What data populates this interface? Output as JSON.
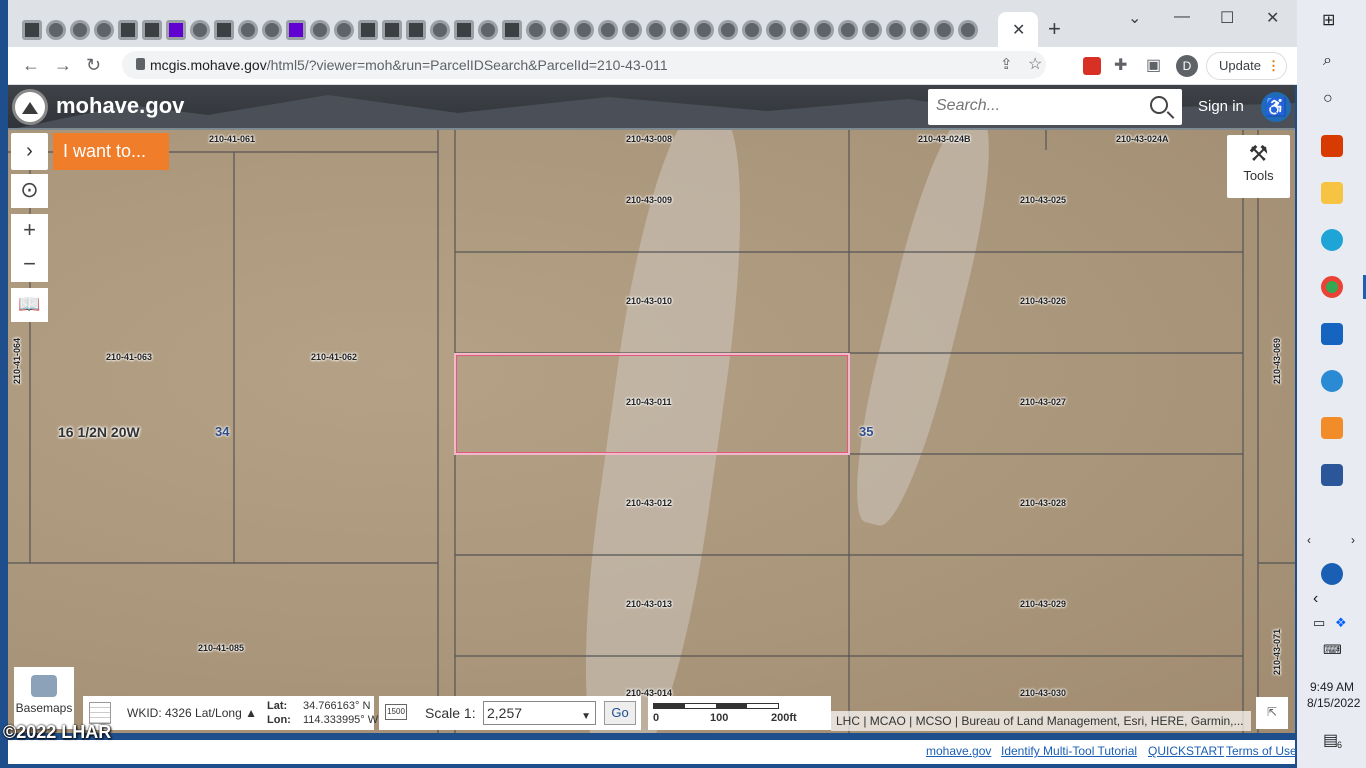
{
  "browser": {
    "url_host": "mcgis.mohave.gov",
    "url_path": "/html5/?viewer=moh&run=ParcelIDSearch&ParcelId=210-43-011",
    "update_label": "Update",
    "profile_initial": "D",
    "new_tab_glyph": "+",
    "close_tab_glyph": "✕"
  },
  "header": {
    "site_name": "mohave.gov",
    "search_placeholder": "Search...",
    "signin_label": "Sign in",
    "accessibility_icon": "accessibility-icon"
  },
  "map_ui": {
    "iwant_label": "I want to...",
    "tools_label": "Tools",
    "basemaps_label": "Basemaps",
    "wkid_label": "WKID: 4326 Lat/Long ▲",
    "lat_label": "Lat:",
    "lon_label": "Lon:",
    "lat_value": "34.766163° N",
    "lon_value": "114.333995° W",
    "scale_label": "Scale 1:",
    "scale_value": "2,257",
    "scale_icon_text": "1500",
    "go_label": "Go",
    "scalebar_ticks": [
      "0",
      "100",
      "200ft"
    ],
    "attribution": "LHC | MCAO | MCSO | Bureau of Land Management, Esri, HERE, Garmin,..."
  },
  "map": {
    "township": "16 1/2N 20W",
    "sections": [
      "34",
      "35"
    ],
    "parcels": [
      "210-41-061",
      "210-43-008",
      "210-43-024B",
      "210-43-024A",
      "210-43-009",
      "210-43-025",
      "210-43-010",
      "210-43-026",
      "210-41-063",
      "210-41-062",
      "210-43-011",
      "210-43-027",
      "210-43-012",
      "210-43-028",
      "210-43-013",
      "210-43-029",
      "210-41-085",
      "210-43-014",
      "210-43-030",
      "210-41-064",
      "210-43-069",
      "210-43-071"
    ],
    "selected_parcel": "210-43-011",
    "colors": {
      "selection": "#e05a7a",
      "iwant": "#f07d2a",
      "brand_blue": "#1a5fb4"
    }
  },
  "footer": {
    "links": [
      "mohave.gov",
      "Identify Multi-Tool Tutorial",
      "QUICKSTART",
      "Terms of Use"
    ]
  },
  "watermark": "©2022 LHAR",
  "taskbar": {
    "time": "9:49 AM",
    "date": "8/15/2022",
    "notification_count": "6"
  }
}
